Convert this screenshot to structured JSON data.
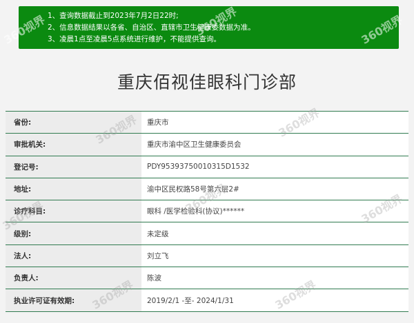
{
  "notice": {
    "lines": [
      "1、查询数据截止到2023年7月2日22时;",
      "2、信息数据结果以各省、自治区、直辖市卫生健康委数据为准。",
      "3、凌晨1点至凌晨5点系统进行维护，不能提供查询。"
    ]
  },
  "title": "重庆佰视佳眼科门诊部",
  "rows": [
    {
      "label": "省份:",
      "value": "重庆市"
    },
    {
      "label": "审批机关:",
      "value": "重庆市渝中区卫生健康委员会"
    },
    {
      "label": "登记号:",
      "value": "PDY95393750010315D1532"
    },
    {
      "label": "地址:",
      "value": "渝中区民权路58号第六层2#"
    },
    {
      "label": "诊疗科目:",
      "value": "眼科 /医学检验科(协议)******"
    },
    {
      "label": "级别:",
      "value": "未定级"
    },
    {
      "label": "法人:",
      "value": "刘立飞"
    },
    {
      "label": "负责人:",
      "value": "陈波"
    },
    {
      "label": "执业许可证有效期:",
      "value": "2019/2/1 -至- 2024/1/31"
    }
  ],
  "watermark": "360视界"
}
